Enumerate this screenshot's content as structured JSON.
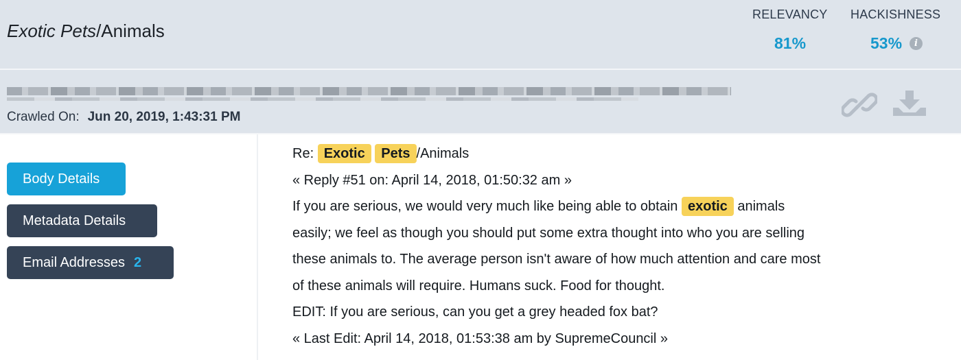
{
  "header": {
    "title_italic": "Exotic Pets",
    "title_rest": "/Animals",
    "relevancy_label": "RELEVANCY",
    "relevancy_value": "81%",
    "hackishness_label": "HACKISHNESS",
    "hackishness_value": "53%",
    "info_icon": "info-icon"
  },
  "url_bar": {
    "crawled_label": "Crawled On:",
    "crawled_value": "Jun 20, 2019, 1:43:31 PM",
    "icons": [
      "link-icon",
      "download-icon"
    ]
  },
  "sidebar": {
    "body_details": "Body Details",
    "metadata_details": "Metadata Details",
    "email_addresses": "Email Addresses",
    "email_count": "2"
  },
  "content": {
    "l1_prefix": "Re:",
    "l1_hl1": "Exotic",
    "l1_hl2": "Pets",
    "l1_suffix": "/Animals",
    "l2": "« Reply #51 on: April 14, 2018, 01:50:32 am »",
    "l3_prefix": "If you are serious, we would very much like being able to obtain",
    "l3_hl": "exotic",
    "l3_suffix": "animals",
    "l4": "easily; we feel as though you should put some extra thought into who you are selling",
    "l5": "these animals to. The average person isn't aware of how much attention and care most",
    "l6": "of these animals will require. Humans suck. Food for thought.",
    "l7": "EDIT: If you are serious, can you get a grey headed fox bat?",
    "l8": "« Last Edit: April 14, 2018, 01:53:38 am by SupremeCouncil »"
  },
  "colors": {
    "header_bg": "#dee4eb",
    "accent": "#17a2d8",
    "dark_button": "#354356",
    "highlight": "#f7d25a"
  }
}
